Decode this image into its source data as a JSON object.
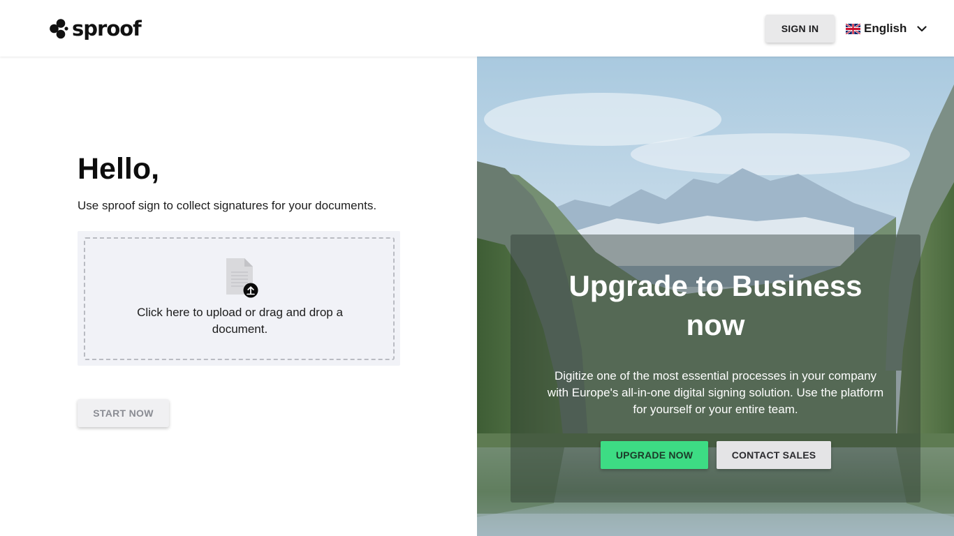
{
  "brand": {
    "name": "sproof",
    "logo_icon": "hexagon-dots-logo-icon"
  },
  "header": {
    "sign_in_label": "SIGN IN",
    "language": {
      "label": "English",
      "flag_icon": "uk-flag-icon",
      "chevron_icon": "chevron-down-icon"
    }
  },
  "main": {
    "greeting": "Hello,",
    "intro": "Use sproof sign to collect signatures for your documents.",
    "upload": {
      "icon": "document-upload-icon",
      "text": "Click here to upload or drag and drop a document."
    },
    "start_label": "START NOW"
  },
  "promo": {
    "title": "Upgrade to Business now",
    "text": "Digitize one of the most essential processes in your company with Europe's all-in-one digital signing solution. Use the platform for yourself or your entire team.",
    "upgrade_label": "UPGRADE NOW",
    "contact_label": "CONTACT SALES"
  },
  "colors": {
    "accent_green": "#3ddc84",
    "button_gray": "#e9e9ea",
    "upload_bg": "#f1f2f7"
  }
}
